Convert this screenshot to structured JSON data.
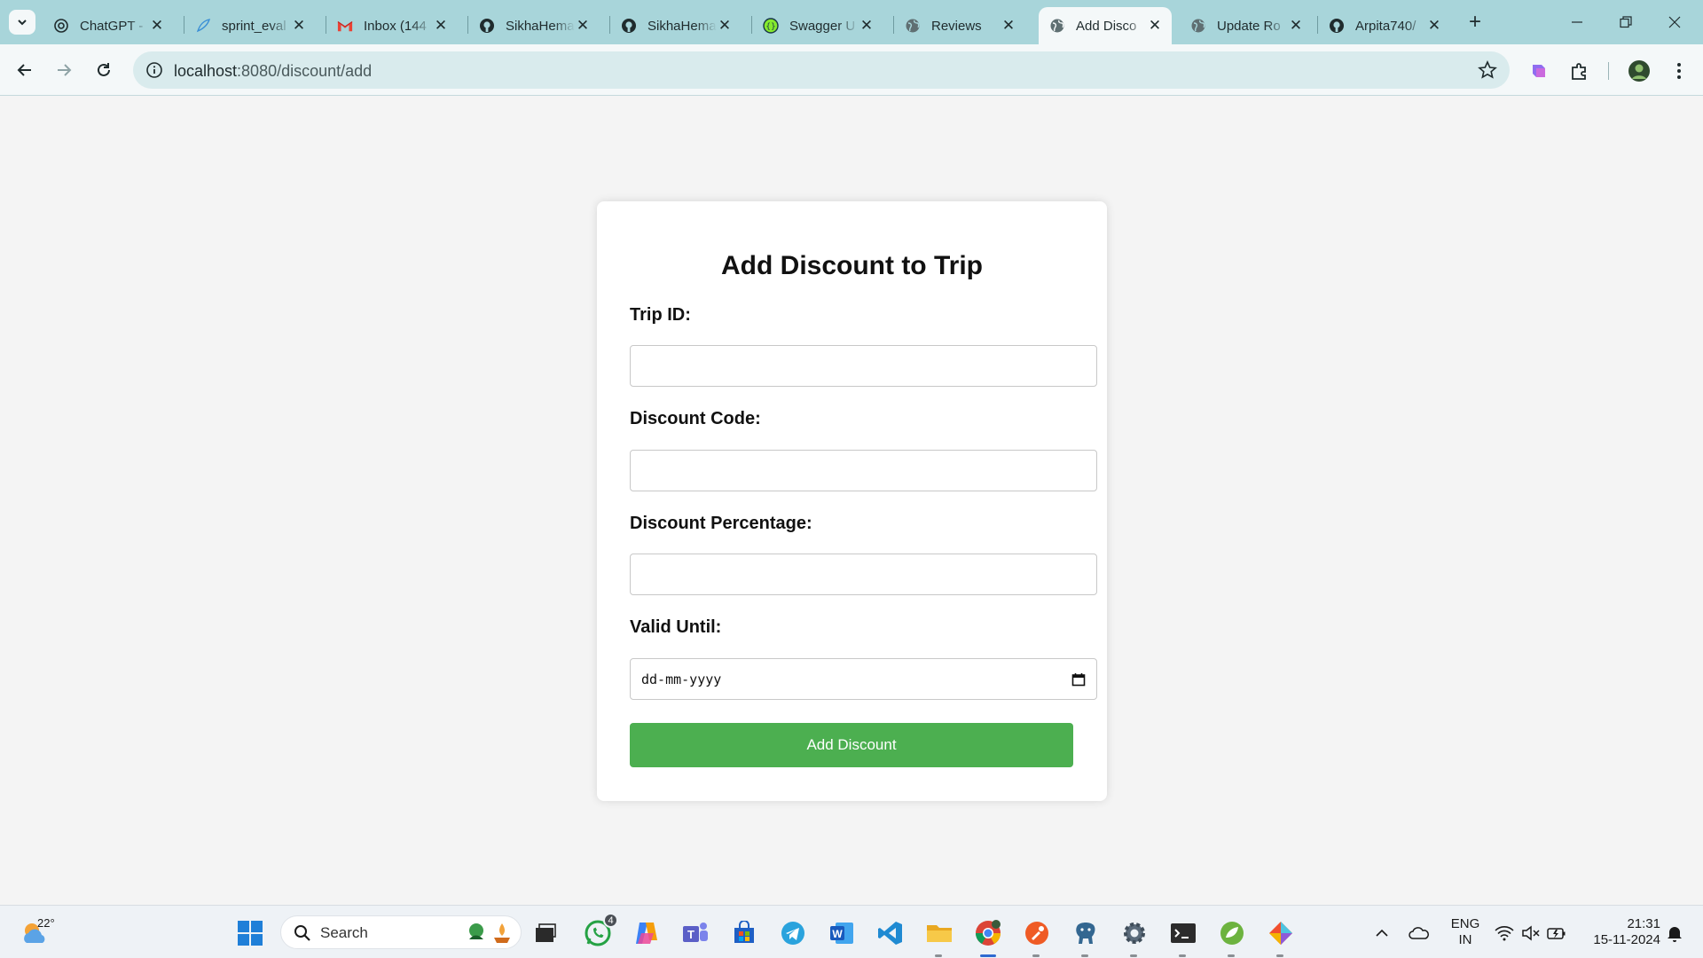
{
  "browser": {
    "tabs": [
      {
        "title": "ChatGPT -",
        "favicon": "chatgpt-icon"
      },
      {
        "title": "sprint_eval",
        "favicon": "mongodb-leaf-icon"
      },
      {
        "title": "Inbox (144",
        "favicon": "gmail-icon"
      },
      {
        "title": "SikhaHema",
        "favicon": "github-icon"
      },
      {
        "title": "SikhaHema",
        "favicon": "github-icon"
      },
      {
        "title": "Swagger U",
        "favicon": "swagger-icon"
      },
      {
        "title": "Reviews",
        "favicon": "globe-icon"
      },
      {
        "title": "Add Disco",
        "favicon": "globe-icon",
        "active": true
      },
      {
        "title": "Update Ro",
        "favicon": "globe-icon"
      },
      {
        "title": "Arpita740/",
        "favicon": "github-icon"
      }
    ],
    "url_host": "localhost",
    "url_path": ":8080/discount/add"
  },
  "page": {
    "title": "Add Discount to Trip",
    "fields": {
      "trip_id_label": "Trip ID:",
      "discount_code_label": "Discount Code:",
      "discount_percentage_label": "Discount Percentage:",
      "valid_until_label": "Valid Until:",
      "valid_until_placeholder": "dd-mm-yyyy"
    },
    "submit_label": "Add Discount",
    "colors": {
      "submit": "#4caf50",
      "background": "#f4f4f4"
    }
  },
  "taskbar": {
    "weather_temp": "22°",
    "search_placeholder": "Search",
    "whatsapp_badge": "4",
    "language": "ENG",
    "region": "IN",
    "time": "21:31",
    "date": "15-11-2024"
  }
}
